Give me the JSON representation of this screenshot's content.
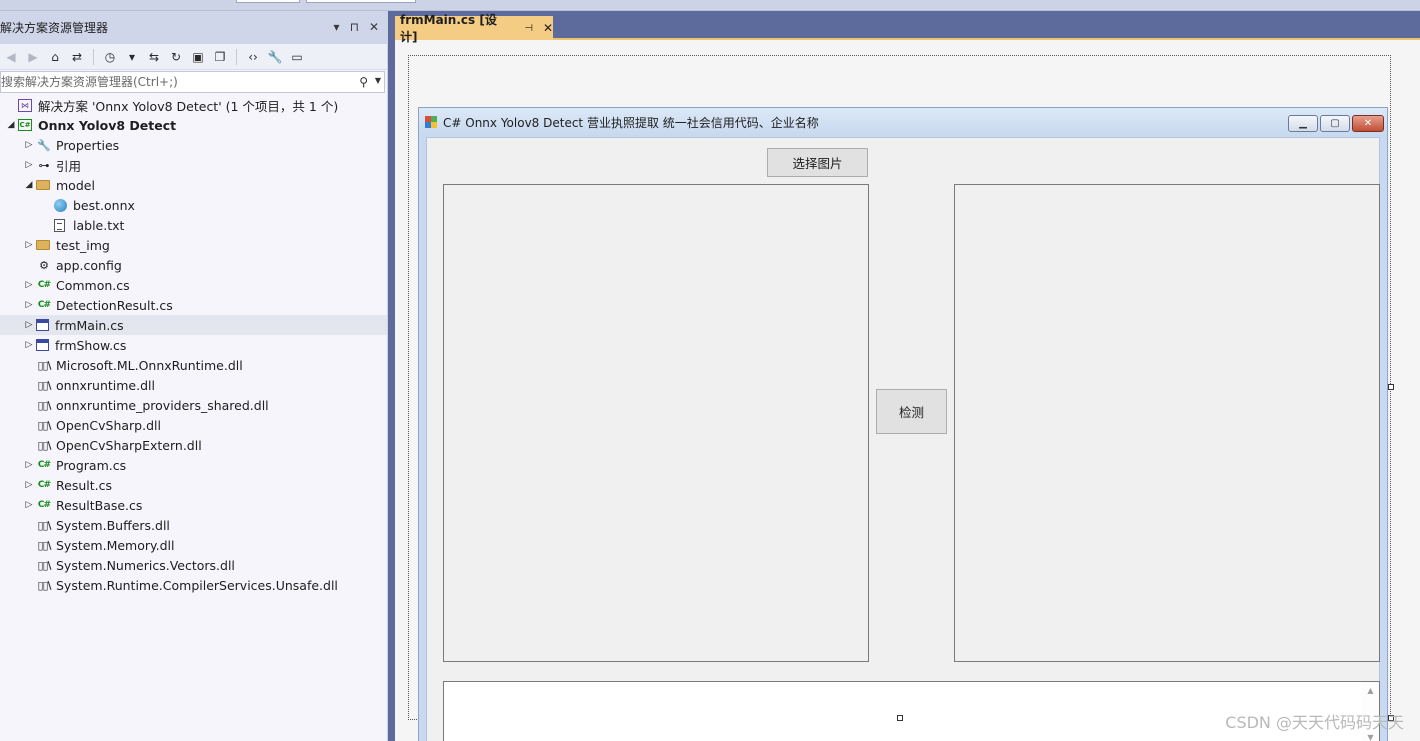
{
  "solution_explorer": {
    "title": "解决方案资源管理器",
    "title_controls": [
      "▾",
      "⊓",
      "✕"
    ],
    "search_placeholder": "搜索解决方案资源管理器(Ctrl+;)",
    "items": [
      {
        "label": "解决方案 'Onnx Yolov8 Detect' (1 个项目，共 1 个)",
        "icon": "solution-icon",
        "level": 0,
        "arrow": ""
      },
      {
        "label": "Onnx Yolov8 Detect",
        "icon": "csharp-project-icon",
        "level": 0,
        "arrow": "◢",
        "bold": true
      },
      {
        "label": "Properties",
        "icon": "wrench-icon",
        "level": 1,
        "arrow": "▷"
      },
      {
        "label": "引用",
        "icon": "references-icon",
        "level": 1,
        "arrow": "▷"
      },
      {
        "label": "model",
        "icon": "folder-icon",
        "level": 1,
        "arrow": "◢"
      },
      {
        "label": "best.onnx",
        "icon": "globe-icon",
        "level": 2,
        "arrow": ""
      },
      {
        "label": "lable.txt",
        "icon": "text-file-icon",
        "level": 2,
        "arrow": ""
      },
      {
        "label": "test_img",
        "icon": "folder-icon",
        "level": 1,
        "arrow": "▷"
      },
      {
        "label": "app.config",
        "icon": "config-icon",
        "level": 1,
        "arrow": ""
      },
      {
        "label": "Common.cs",
        "icon": "csharp-file-icon",
        "level": 1,
        "arrow": "▷"
      },
      {
        "label": "DetectionResult.cs",
        "icon": "csharp-file-icon",
        "level": 1,
        "arrow": "▷"
      },
      {
        "label": "frmMain.cs",
        "icon": "form-icon",
        "level": 1,
        "arrow": "▷",
        "selected": true
      },
      {
        "label": "frmShow.cs",
        "icon": "form-icon",
        "level": 1,
        "arrow": "▷"
      },
      {
        "label": "Microsoft.ML.OnnxRuntime.dll",
        "icon": "library-icon",
        "level": 1,
        "arrow": ""
      },
      {
        "label": "onnxruntime.dll",
        "icon": "library-icon",
        "level": 1,
        "arrow": ""
      },
      {
        "label": "onnxruntime_providers_shared.dll",
        "icon": "library-icon",
        "level": 1,
        "arrow": ""
      },
      {
        "label": "OpenCvSharp.dll",
        "icon": "library-icon",
        "level": 1,
        "arrow": ""
      },
      {
        "label": "OpenCvSharpExtern.dll",
        "icon": "library-icon",
        "level": 1,
        "arrow": ""
      },
      {
        "label": "Program.cs",
        "icon": "csharp-file-icon",
        "level": 1,
        "arrow": "▷"
      },
      {
        "label": "Result.cs",
        "icon": "csharp-file-icon",
        "level": 1,
        "arrow": "▷"
      },
      {
        "label": "ResultBase.cs",
        "icon": "csharp-file-icon",
        "level": 1,
        "arrow": "▷"
      },
      {
        "label": "System.Buffers.dll",
        "icon": "library-icon",
        "level": 1,
        "arrow": ""
      },
      {
        "label": "System.Memory.dll",
        "icon": "library-icon",
        "level": 1,
        "arrow": ""
      },
      {
        "label": "System.Numerics.Vectors.dll",
        "icon": "library-icon",
        "level": 1,
        "arrow": ""
      },
      {
        "label": "System.Runtime.CompilerServices.Unsafe.dll",
        "icon": "library-icon",
        "level": 1,
        "arrow": ""
      }
    ]
  },
  "document_tab": {
    "label": "frmMain.cs [设计]",
    "pin": "⊣",
    "close": "✕"
  },
  "winform": {
    "title": "C# Onnx Yolov8 Detect  营业执照提取 统一社会信用代码、企业名称",
    "select_image_button": "选择图片",
    "detect_button": "检测",
    "output_text": ""
  },
  "watermark": "CSDN @天天代码码天天",
  "colors": {
    "tab_active": "#f5cc84",
    "splitter": "#5d6a9c",
    "selection": "#e3e5ef"
  }
}
